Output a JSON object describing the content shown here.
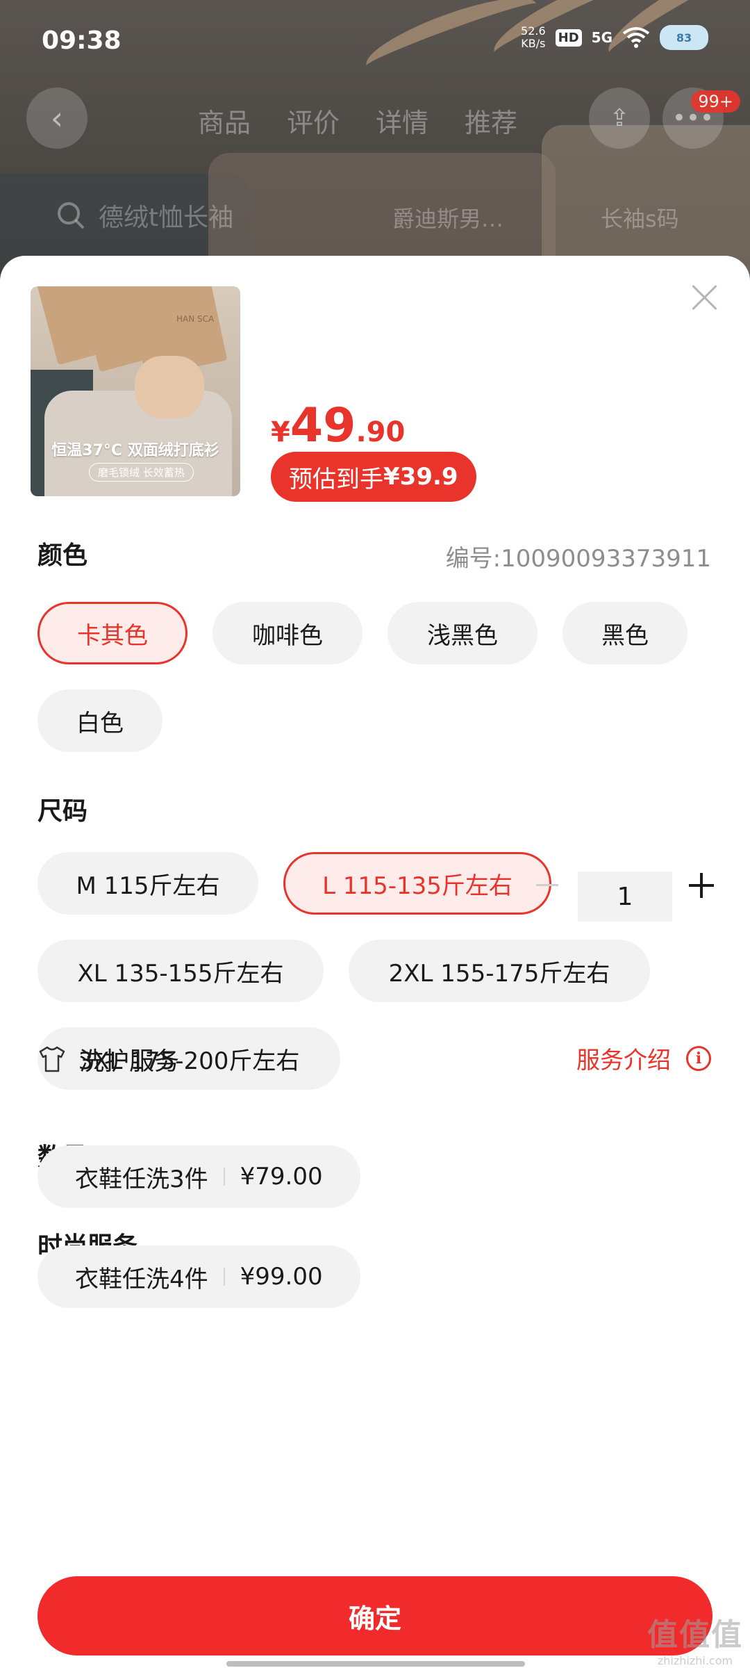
{
  "status_bar": {
    "time": "09:38",
    "net_speed_value": "52.6",
    "net_speed_unit": "KB/s",
    "hd_label": "HD",
    "signal_label": "5G",
    "battery_label": "83"
  },
  "nav": {
    "tabs": [
      "商品",
      "评价",
      "详情",
      "推荐"
    ],
    "messages_badge": "99+"
  },
  "search": {
    "query": "德绒t恤长袖",
    "suggestions": [
      "爵迪斯男…",
      "长袖s码"
    ]
  },
  "product": {
    "thumb_caption": "恒温37°C 双面绒打底衫",
    "thumb_subcaption": "磨毛锁绒 长效蓄热",
    "thumb_brand": "HAN SCA",
    "price_currency": "¥",
    "price_integer": "49",
    "price_decimal": ".90",
    "estimate_prefix": "预估到手",
    "estimate_price": "¥39.9"
  },
  "color": {
    "title": "颜色",
    "sku_label": "编号:10090093373911",
    "options": [
      "卡其色",
      "咖啡色",
      "浅黑色",
      "黑色",
      "白色"
    ],
    "selected": "卡其色"
  },
  "size": {
    "title": "尺码",
    "options": [
      "M 115斤左右",
      "L 115-135斤左右",
      "XL 135-155斤左右",
      "2XL 155-175斤左右",
      "3XL 175-200斤左右"
    ],
    "selected": "L 115-135斤左右"
  },
  "quantity": {
    "title": "数量",
    "value": "1"
  },
  "services": {
    "title": "时尚服务",
    "wash_label": "洗护服务",
    "intro_label": "服务介绍",
    "items": [
      {
        "name": "衣鞋任洗3件",
        "price": "¥79.00"
      },
      {
        "name": "衣鞋任洗4件",
        "price": "¥99.00"
      }
    ]
  },
  "confirm_label": "确定",
  "watermark": {
    "big": "值值值",
    "small": "zhizhizhi.com"
  },
  "colors": {
    "accent": "#e8342b",
    "chip_bg": "#f2f2f2",
    "selected_bg": "#fdecea",
    "confirm": "#f12b2b"
  },
  "icons": [
    "back-arrow-icon",
    "share-icon",
    "more-icon",
    "search-icon",
    "close-icon",
    "tshirt-icon",
    "info-icon",
    "minus-icon",
    "plus-icon",
    "wifi-icon",
    "battery-icon"
  ]
}
